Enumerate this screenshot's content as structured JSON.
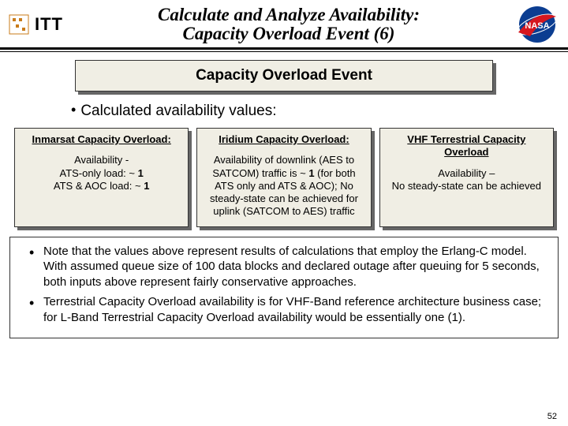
{
  "header": {
    "itt_text": "ITT",
    "title_line1": "Calculate and Analyze Availability:",
    "title_line2": "Capacity Overload Event (6)"
  },
  "section_title": "Capacity Overload Event",
  "bullet_intro": "Calculated availability values:",
  "columns": {
    "inmarsat": {
      "heading": "Inmarsat Capacity Overload:",
      "line1": "Availability -",
      "line2": "ATS-only load: ~ ",
      "line2_bold": "1",
      "line3": "ATS & AOC load: ~ ",
      "line3_bold": "1"
    },
    "iridium": {
      "heading": "Iridium Capacity Overload:",
      "body_pre": "Availability of downlink (AES to SATCOM) traffic is ~ ",
      "body_bold": "1",
      "body_post": " (for both ATS only and ATS & AOC); No steady-state can be achieved for uplink (SATCOM to AES) traffic"
    },
    "vhf": {
      "heading": "VHF Terrestrial Capacity Overload",
      "line1": "Availability –",
      "line2": "No steady-state can be achieved"
    }
  },
  "notes": {
    "n1": "Note that the values above represent results of calculations that employ the Erlang-C model.  With assumed queue size of 100 data blocks and declared outage after queuing for 5 seconds, both inputs above represent fairly conservative approaches.",
    "n2": "Terrestrial Capacity Overload availability is for VHF-Band reference architecture business case; for L-Band Terrestrial Capacity Overload availability would be essentially one (1)."
  },
  "pagenum": "52"
}
